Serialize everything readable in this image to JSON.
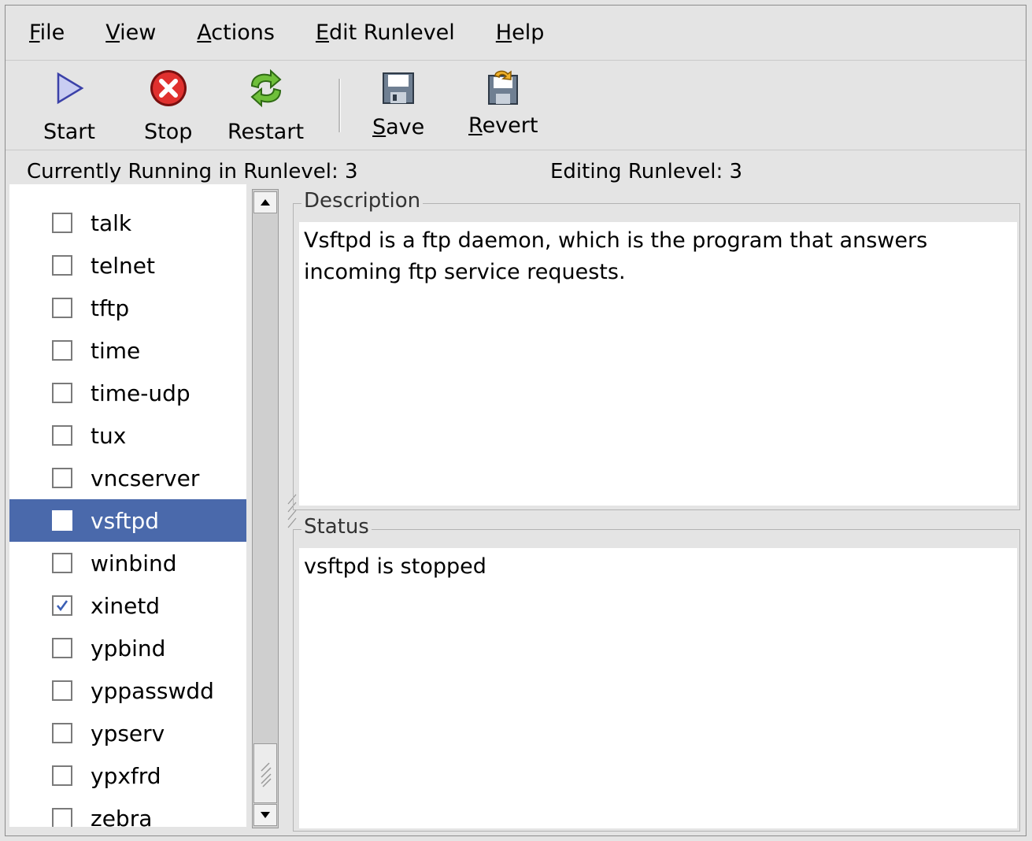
{
  "menubar": {
    "items": [
      {
        "pre": "",
        "u": "F",
        "post": "ile"
      },
      {
        "pre": "",
        "u": "V",
        "post": "iew"
      },
      {
        "pre": "",
        "u": "A",
        "post": "ctions"
      },
      {
        "pre": "",
        "u": "E",
        "post": "dit Runlevel"
      },
      {
        "pre": "",
        "u": "H",
        "post": "elp"
      }
    ]
  },
  "toolbar": {
    "start": {
      "label": "Start",
      "icon": "play-triangle-icon"
    },
    "stop": {
      "label": "Stop",
      "icon": "stop-x-icon"
    },
    "restart": {
      "label": "Restart",
      "icon": "restart-arrows-icon"
    },
    "save": {
      "u": "S",
      "rest": "ave",
      "icon": "floppy-save-icon"
    },
    "revert": {
      "u": "R",
      "rest": "evert",
      "icon": "floppy-revert-icon"
    }
  },
  "status_line": {
    "running": "Currently Running in Runlevel: 3",
    "editing": "Editing Runlevel: 3"
  },
  "services": [
    {
      "name": "talk",
      "checked": false
    },
    {
      "name": "telnet",
      "checked": false
    },
    {
      "name": "tftp",
      "checked": false
    },
    {
      "name": "time",
      "checked": false
    },
    {
      "name": "time-udp",
      "checked": false
    },
    {
      "name": "tux",
      "checked": false
    },
    {
      "name": "vncserver",
      "checked": false
    },
    {
      "name": "vsftpd",
      "checked": false,
      "selected": true
    },
    {
      "name": "winbind",
      "checked": false
    },
    {
      "name": "xinetd",
      "checked": true
    },
    {
      "name": "ypbind",
      "checked": false
    },
    {
      "name": "yppasswdd",
      "checked": false
    },
    {
      "name": "ypserv",
      "checked": false
    },
    {
      "name": "ypxfrd",
      "checked": false
    },
    {
      "name": "zebra",
      "checked": false
    }
  ],
  "description": {
    "title": "Description",
    "text": "Vsftpd is a ftp daemon, which is the program that answers incoming ftp service requests."
  },
  "status": {
    "title": "Status",
    "text": "vsftpd is stopped"
  },
  "colors": {
    "selection": "#4a69ab",
    "check": "#3b5fb5"
  }
}
